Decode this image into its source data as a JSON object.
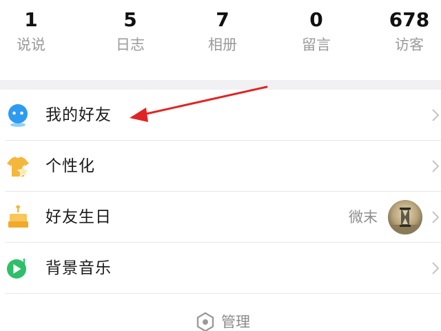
{
  "stats": [
    {
      "count": "1",
      "label": "说说"
    },
    {
      "count": "5",
      "label": "日志"
    },
    {
      "count": "7",
      "label": "相册"
    },
    {
      "count": "0",
      "label": "留言"
    },
    {
      "count": "678",
      "label": "访客"
    }
  ],
  "menu": {
    "items": [
      {
        "label": "我的好友",
        "icon": "friends-robot-icon",
        "icon_color": "#2e9bf0"
      },
      {
        "label": "个性化",
        "icon": "tshirt-star-icon",
        "icon_color": "#f5b73b"
      },
      {
        "label": "好友生日",
        "icon": "birthday-cake-icon",
        "icon_color": "#f5b73b",
        "right_text": "微末"
      },
      {
        "label": "背景音乐",
        "icon": "music-play-icon",
        "icon_color": "#2fbf6a"
      }
    ]
  },
  "footer": {
    "manage_label": "管理",
    "icon": "hexagon-settings-icon"
  },
  "annotation": {
    "arrow_color": "#e02424",
    "arrow_target": "我的好友"
  }
}
